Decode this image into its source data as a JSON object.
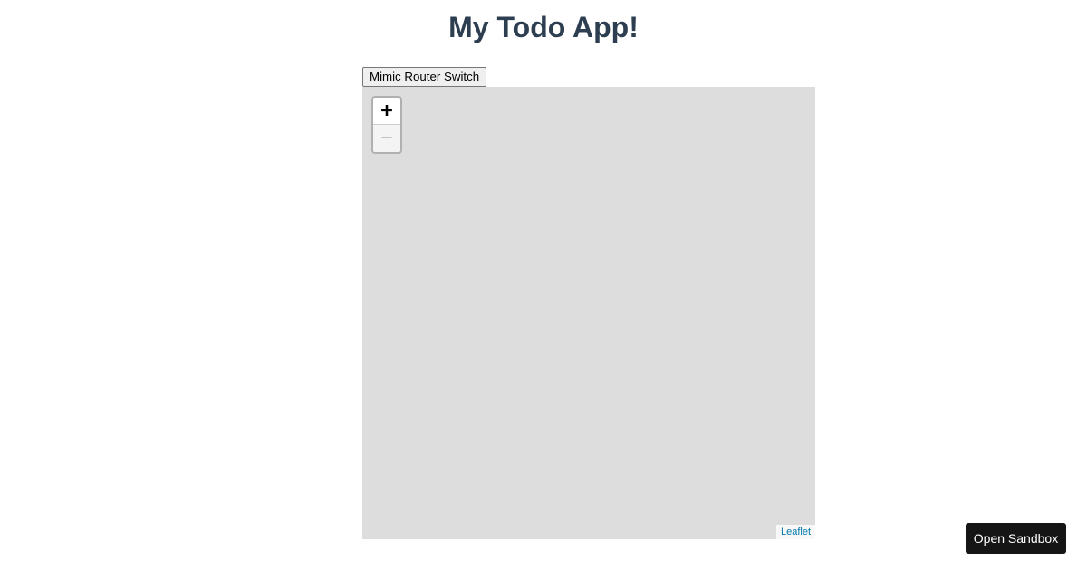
{
  "header": {
    "title": "My Todo App!"
  },
  "controls": {
    "router_switch_label": "Mimic Router Switch"
  },
  "map": {
    "zoom_in_label": "+",
    "zoom_out_label": "−",
    "attribution_link": "Leaflet",
    "background_color": "#dddddd"
  },
  "sandbox": {
    "open_label": "Open Sandbox"
  },
  "colors": {
    "title": "#2c3e50",
    "link": "#0078a8",
    "sandbox_bg": "#151515"
  }
}
